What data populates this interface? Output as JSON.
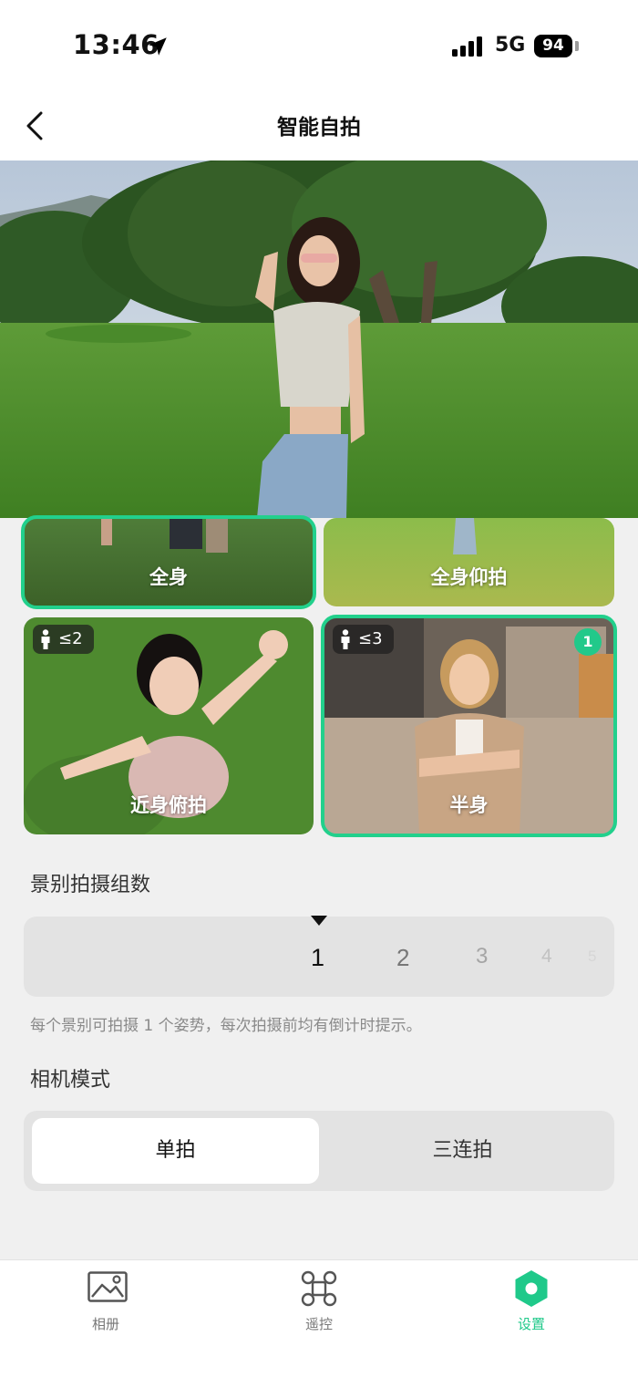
{
  "status_bar": {
    "time": "13:46",
    "network": "5G",
    "battery": "94"
  },
  "nav": {
    "title": "智能自拍"
  },
  "cards": [
    {
      "label": "全身",
      "selected": true
    },
    {
      "label": "全身仰拍",
      "selected": false
    },
    {
      "label": "近身俯拍",
      "badge": "≤2",
      "selected": false
    },
    {
      "label": "半身",
      "badge": "≤3",
      "selected": true,
      "selection_index": "1"
    }
  ],
  "groups": {
    "title": "景别拍摄组数",
    "options": [
      "1",
      "2",
      "3",
      "4",
      "5"
    ],
    "selected": "1",
    "hint": "每个景别可拍摄 1 个姿势，每次拍摄前均有倒计时提示。"
  },
  "camera_mode": {
    "title": "相机模式",
    "options": [
      "单拍",
      "三连拍"
    ],
    "selected": "单拍"
  },
  "tabbar": {
    "items": [
      {
        "label": "相册",
        "icon": "album-icon"
      },
      {
        "label": "遥控",
        "icon": "drone-icon"
      },
      {
        "label": "设置",
        "icon": "settings-hexagon-icon",
        "active": true
      }
    ]
  },
  "colors": {
    "accent": "#22d08c",
    "background": "#f0f0f0"
  }
}
